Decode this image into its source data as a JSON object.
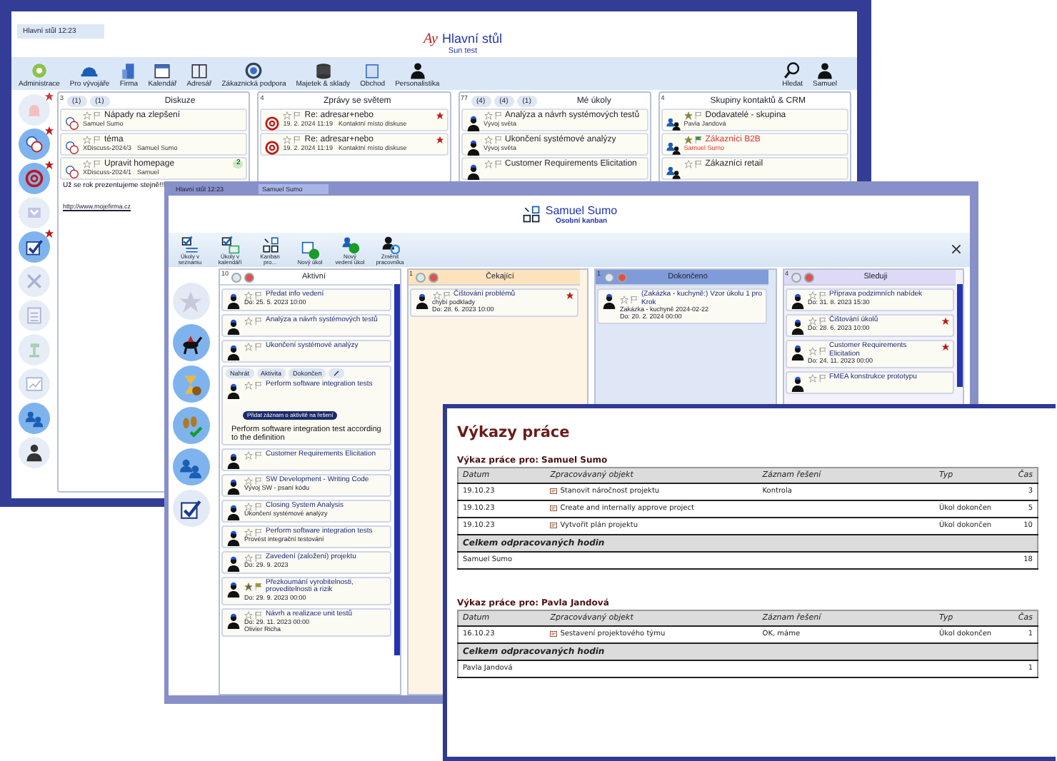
{
  "back_window": {
    "tab": "Hlavní stůl 12:23",
    "logo": "Ay",
    "title": "Hlavní stůl",
    "subtitle": "Sun test",
    "toolbar": [
      {
        "label": "Administrace"
      },
      {
        "label": "Pro vývojáře"
      },
      {
        "label": "Firma"
      },
      {
        "label": "Kalendář"
      },
      {
        "label": "Adresář"
      },
      {
        "label": "Zákaznická podpora"
      },
      {
        "label": "Majetek & sklady"
      },
      {
        "label": "Obchod"
      },
      {
        "label": "Personalistika"
      }
    ],
    "toolbar_right": [
      {
        "label": "Hledat"
      },
      {
        "label": "Samuel"
      }
    ],
    "sidebar": [
      {
        "active": false,
        "badge": true
      },
      {
        "active": true,
        "badge": true
      },
      {
        "active": true,
        "badge": true
      },
      {
        "active": false,
        "badge": false
      },
      {
        "active": true,
        "badge": true
      },
      {
        "active": false,
        "badge": false
      },
      {
        "active": false,
        "badge": false
      },
      {
        "active": false,
        "badge": false
      },
      {
        "active": false,
        "badge": false
      },
      {
        "active": true,
        "badge": false
      },
      {
        "active": false,
        "badge": false
      }
    ],
    "columns": [
      {
        "count": "3",
        "filters": [
          "(1)",
          "(1)"
        ],
        "title": "Diskuze",
        "cards": [
          {
            "title": "Nápady na zlepšení",
            "meta": [
              "Samuel Sumo"
            ],
            "starred": false,
            "flagged": false,
            "important": false,
            "alert": false
          },
          {
            "title": "téma",
            "meta": [
              "XDiscuss-2024/3",
              "Samuel Sumo"
            ],
            "starred": false,
            "flagged": false,
            "important": false,
            "alert": false
          },
          {
            "title": "Upravit homepage",
            "meta": [
              "XDiscuss-2024/1",
              "Samuel"
            ],
            "starred": false,
            "flagged": false,
            "important": false,
            "alert": false,
            "badge": "2",
            "body": "Už se rok prezentujeme stejně!!!",
            "link": "http://www.mojefirma.cz"
          }
        ]
      },
      {
        "count": "4",
        "title": "Zprávy se světem",
        "cards": [
          {
            "title": "Re: adresar+nebo",
            "meta": [
              "19. 2. 2024 11:19",
              "Kontaktní místo diskuse"
            ],
            "starred": false,
            "flagged": false,
            "important": true,
            "alert": false
          },
          {
            "title": "Re: adresar+nebo",
            "meta": [
              "19. 2. 2024 11:19",
              "Kontaktní místo diskuse"
            ],
            "starred": false,
            "flagged": false,
            "important": true,
            "alert": false
          }
        ]
      },
      {
        "count": "77",
        "filters": [
          "(4)",
          "(4)",
          "(1)"
        ],
        "title": "Mé úkoly",
        "cards": [
          {
            "title": "Analýza a návrh systémových testů",
            "meta": [
              "Vývoj světa"
            ],
            "starred": false,
            "flagged": false,
            "important": false,
            "alert": false
          },
          {
            "title": "Ukončení systémové analýzy",
            "meta": [
              "Vývoj světa"
            ],
            "starred": false,
            "flagged": false,
            "important": false,
            "alert": false
          },
          {
            "title": "Customer Requirements Elicitation",
            "starred": false,
            "flagged": false,
            "important": false,
            "alert": false
          }
        ]
      },
      {
        "count": "4",
        "title": "Skupiny kontaktů & CRM",
        "cards": [
          {
            "title": "Dodavatelé - skupina",
            "meta": [
              "Pavla Jandová"
            ],
            "starred": true,
            "flagged": false,
            "important": false,
            "alert": false
          },
          {
            "title": "Zákazníci B2B",
            "meta": [
              "Samuel Sumo"
            ],
            "starred": true,
            "flagged": true,
            "important": false,
            "alert": true
          },
          {
            "title": "Zákazníci retail",
            "starred": false,
            "flagged": false,
            "important": false,
            "alert": false
          }
        ]
      }
    ]
  },
  "kanban_window": {
    "tabs": [
      {
        "label": "Hlavní stůl 12:23",
        "selected": false
      },
      {
        "label": "Samuel Sumo",
        "selected": true
      }
    ],
    "title": "Samuel Sumo",
    "subtitle": "Osobní kanban",
    "toolbar": [
      {
        "label": "Úkoly v seznamu"
      },
      {
        "label": "Úkoly v kalendáři"
      },
      {
        "label": "Kanban pro..."
      },
      {
        "label": "Nový úkol"
      },
      {
        "label": "Nový vedení úkol"
      },
      {
        "label": "Změnit pracovníka"
      }
    ],
    "sidebar": [
      {
        "active": false
      },
      {
        "active": true
      },
      {
        "active": true
      },
      {
        "active": true
      },
      {
        "active": true
      },
      {
        "active": false
      }
    ],
    "columns": [
      {
        "count": "10",
        "title": "Aktivní",
        "color": "#ffffff",
        "cards": [
          {
            "title": "Předat info vedení",
            "meta": [
              "Do: 25. 5. 2023 10:00"
            ],
            "starred": false,
            "flagged": false,
            "important": false
          },
          {
            "title": "Analýza a návrh systémových testů",
            "starred": false,
            "flagged": false,
            "important": false
          },
          {
            "title": "Ukončení systémové analýzy",
            "starred": false,
            "flagged": false,
            "important": false
          },
          {
            "title": "Perform software integration tests",
            "starred": false,
            "flagged": false,
            "important": false,
            "actions": [
              "Nahrát",
              "Aktivita",
              "Dokončen"
            ],
            "tooltip": "Přidat záznam o aktivitě na řešení",
            "body": "Perform software integration test according to the definition"
          },
          {
            "title": "Customer Requirements Elicitation",
            "starred": false,
            "flagged": false,
            "important": false
          },
          {
            "title": "SW Development - Writing Code",
            "meta": [
              "Vývoj SW - psaní kódu"
            ],
            "starred": false,
            "flagged": false,
            "important": false
          },
          {
            "title": "Closing System Analysis",
            "meta": [
              "Ukončení systémové analýzy"
            ],
            "starred": false,
            "flagged": false,
            "important": false
          },
          {
            "title": "Perform software integration tests",
            "meta": [
              "Provést integrační testování"
            ],
            "starred": false,
            "flagged": false,
            "important": false
          },
          {
            "title": "Zavedení (založení) projektu",
            "meta": [
              "Do: 29. 9. 2023"
            ],
            "starred": false,
            "flagged": false,
            "important": false
          },
          {
            "title": "Přezkoumání vyrobitelnosti, proveditelnosti a rizik",
            "meta": [
              "Do: 29. 9. 2023 00:00"
            ],
            "starred": true,
            "flagged": true,
            "important": false
          },
          {
            "title": "Návrh a realizace unit testů",
            "meta": [
              "Do: 29. 11. 2023 00:00",
              "Olivier Richa"
            ],
            "starred": false,
            "flagged": false,
            "important": false
          }
        ]
      },
      {
        "count": "1",
        "title": "Čekající",
        "color": "#fde3bd",
        "cards": [
          {
            "title": "Čištování problémů",
            "meta": [
              "chybí podklady",
              "Do: 28. 6. 2023 10:00"
            ],
            "starred": false,
            "flagged": false,
            "important": true
          }
        ]
      },
      {
        "count": "1",
        "title": "Dokončeno",
        "color": "#7f9bd9",
        "cards": [
          {
            "title": "(Zakázka - kuchyně:) Vzor úkolu 1 pro Krok",
            "meta": [
              "Zakázka - kuchyně 2024-02-22",
              "Do: 20. 2. 2024 00:00"
            ],
            "starred": false,
            "flagged": false,
            "important": false
          }
        ]
      },
      {
        "count": "4",
        "title": "Sleduji",
        "color": "#ddd9f6",
        "cards": [
          {
            "title": "Příprava podzimních nabídek",
            "meta": [
              "Do: 31. 8. 2023 15:30"
            ],
            "starred": false,
            "flagged": false,
            "important": false
          },
          {
            "title": "Čištování úkolů",
            "meta": [
              "Do: 28. 6. 2023 10:00"
            ],
            "starred": false,
            "flagged": false,
            "important": true
          },
          {
            "title": "Customer Requirements Elicitation",
            "meta": [
              "Do: 24. 11. 2023 00:00"
            ],
            "starred": false,
            "flagged": false,
            "important": true
          },
          {
            "title": "FMEA konstrukce prototypu",
            "starred": false,
            "flagged": false,
            "important": false
          }
        ]
      }
    ]
  },
  "report": {
    "title": "Výkazy práce",
    "sections": [
      {
        "heading": "Výkaz práce pro: Samuel Sumo",
        "columns": [
          "Datum",
          "Zpracovávaný objekt",
          "Záznam řešení",
          "Typ",
          "Čas"
        ],
        "rows": [
          {
            "date": "19.10.23",
            "object": "Stanovit náročnost projektu",
            "record": "Kontrola",
            "hours": "3"
          },
          {
            "date": "19.10.23",
            "object": "Create and internally approve project",
            "type": "Úkol dokončen",
            "hours": "5"
          },
          {
            "date": "19.10.23",
            "object": "Vytvořit plán projektu",
            "type": "Úkol dokončen",
            "hours": "10"
          }
        ],
        "total_label": "Celkem odpracovaných hodin",
        "total_name": "Samuel Sumo",
        "total": "18"
      },
      {
        "heading": "Výkaz práce pro: Pavla Jandová",
        "columns": [
          "Datum",
          "Zpracovávaný objekt",
          "Záznam řešení",
          "Typ",
          "Čas"
        ],
        "rows": [
          {
            "date": "16.10.23",
            "object": "Sestavení projektového týmu",
            "record": "OK, máme",
            "type": "Úkol dokončen",
            "hours": "1"
          }
        ],
        "total_label": "Celkem odpracovaných hodin",
        "total_name": "Pavla Jandová",
        "total": "1"
      }
    ]
  }
}
